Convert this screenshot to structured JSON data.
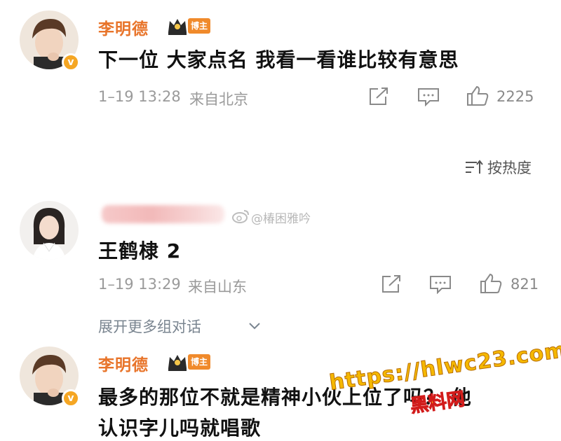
{
  "comments": [
    {
      "username": "李明德",
      "tag": "博主",
      "content": "下一位 大家点名 我看一看谁比较有意思",
      "date": "1–19 13:28",
      "location": "来自北京",
      "likes": "2225"
    },
    {
      "watermark": "@椿困雅吟",
      "content": "王鹤棣 2",
      "date": "1–19 13:29",
      "location": "来自山东",
      "likes": "821"
    },
    {
      "username": "李明德",
      "tag": "博主",
      "content_line1": "最多的那位不就是精神小伙上位了吗？ 他",
      "content_line2": "认识字儿吗就唱歌"
    }
  ],
  "sort_label": "按热度",
  "expand_label": "展开更多组对话",
  "overlay": {
    "url": "https://hlwc23.com",
    "site": "黑料网"
  },
  "colors": {
    "username": "#e8742a",
    "tag": "#f08a2b",
    "meta": "#9a9a9a",
    "overlay_url": "#f5b800"
  }
}
